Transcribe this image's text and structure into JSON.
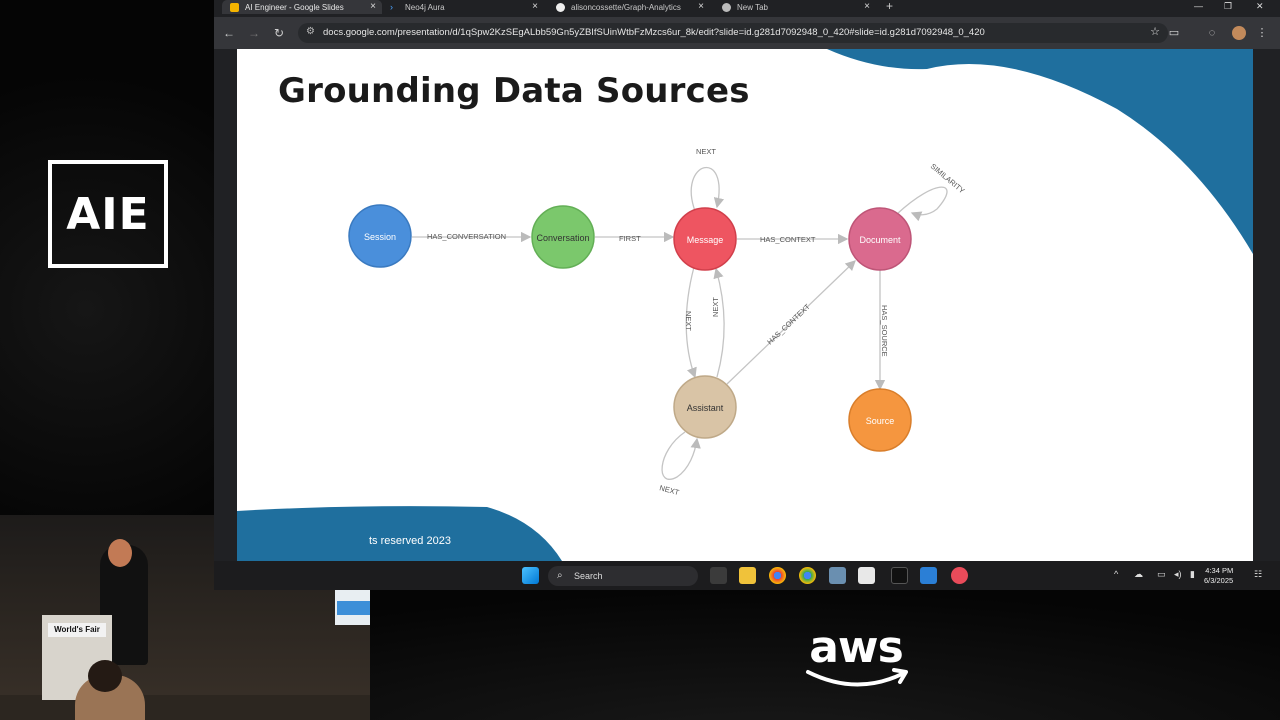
{
  "branding": {
    "event_logo": "AIE",
    "sponsor_logo": "aws"
  },
  "browser": {
    "tabs": [
      {
        "title": "AI Engineer - Google Slides",
        "icon": "slides-icon",
        "active": true
      },
      {
        "title": "Neo4j Aura",
        "icon": "neo4j-icon",
        "active": false
      },
      {
        "title": "alisoncossette/Graph-Analytics",
        "icon": "github-icon",
        "active": false
      },
      {
        "title": "New Tab",
        "icon": "chrome-icon",
        "active": false
      }
    ],
    "url": "docs.google.com/presentation/d/1qSpw2KzSEgALbb59Gn5yZBIfSUinWtbFzMzcs6ur_8k/edit?slide=id.g281d7092948_0_420#slide=id.g281d7092948_0_420"
  },
  "slide": {
    "title": "Grounding Data Sources",
    "footer": "ts reserved 2023",
    "nodes": [
      {
        "id": "session",
        "label": "Session",
        "color": "#4A8FDB"
      },
      {
        "id": "conversation",
        "label": "Conversation",
        "color": "#7BC86C"
      },
      {
        "id": "message",
        "label": "Message",
        "color": "#EE5561"
      },
      {
        "id": "document",
        "label": "Document",
        "color": "#DA6A8E"
      },
      {
        "id": "assistant",
        "label": "Assistant",
        "color": "#D9C4A6"
      },
      {
        "id": "source",
        "label": "Source",
        "color": "#F5963F"
      }
    ],
    "edges": [
      {
        "label": "HAS_CONVERSATION"
      },
      {
        "label": "FIRST"
      },
      {
        "label": "HAS_CONTEXT"
      },
      {
        "label": "NEXT"
      },
      {
        "label": "SIMILARITY"
      },
      {
        "label": "NEXT"
      },
      {
        "label": "NEXT"
      },
      {
        "label": "HAS_CONTEXT"
      },
      {
        "label": "HAS_SOURCE"
      },
      {
        "label": "NEXT"
      }
    ]
  },
  "podium": {
    "label": "World's Fair"
  },
  "taskbar": {
    "search_placeholder": "Search",
    "time": "4:34 PM",
    "date": "6/3/2025"
  },
  "colors": {
    "slide_accent": "#1F6F9E",
    "browser_bg": "#202124"
  }
}
